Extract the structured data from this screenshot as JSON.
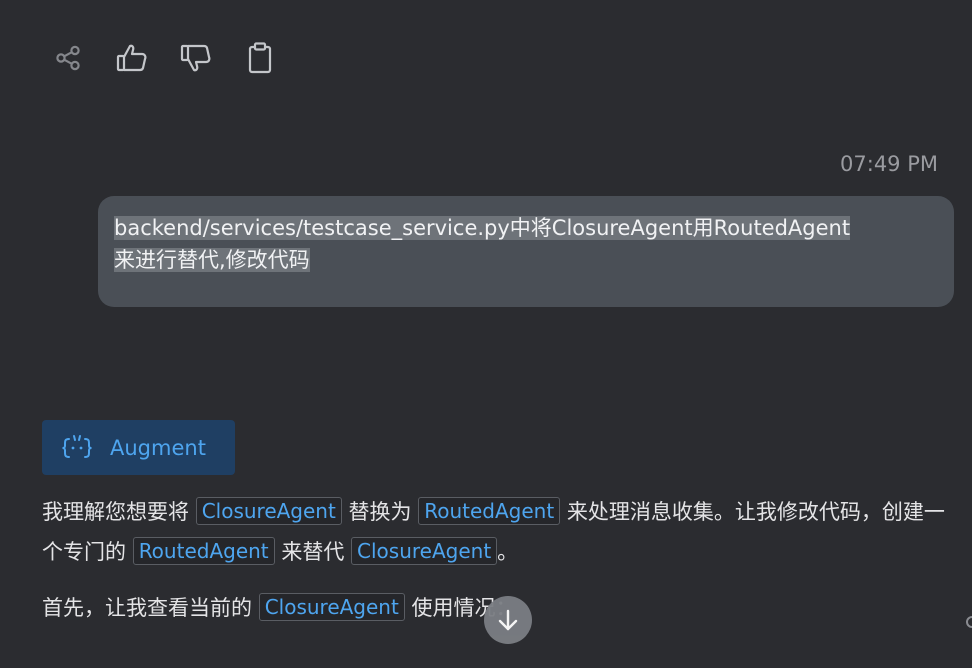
{
  "toolbar": {
    "icons": [
      "share-icon",
      "thumbs-up-icon",
      "thumbs-down-icon",
      "clipboard-icon"
    ]
  },
  "timestamp": "07:49 PM",
  "user_message": {
    "line1": "backend/services/testcase_service.py中将ClosureAgent用RoutedAgent",
    "line2": "来进行替代,修改代码"
  },
  "assistant": {
    "name": "Augment",
    "p1": {
      "t1": "我理解您想要将",
      "c1": "ClosureAgent",
      "t2": "替换为",
      "c2": "RoutedAgent",
      "t3": "来处理消息收集。让我修改代码，创建一个专门的",
      "c3": "RoutedAgent",
      "t4": "来替代",
      "c4": "ClosureAgent",
      "t5": "。"
    },
    "p2": {
      "t1": "首先，让我查看当前的",
      "c1": "ClosureAgent",
      "t2": "使用情况："
    }
  },
  "colors": {
    "background": "#2b2c30",
    "user_bubble": "#4a4f56",
    "accent": "#4ea5ef",
    "badge_bg": "#1f3f63"
  }
}
